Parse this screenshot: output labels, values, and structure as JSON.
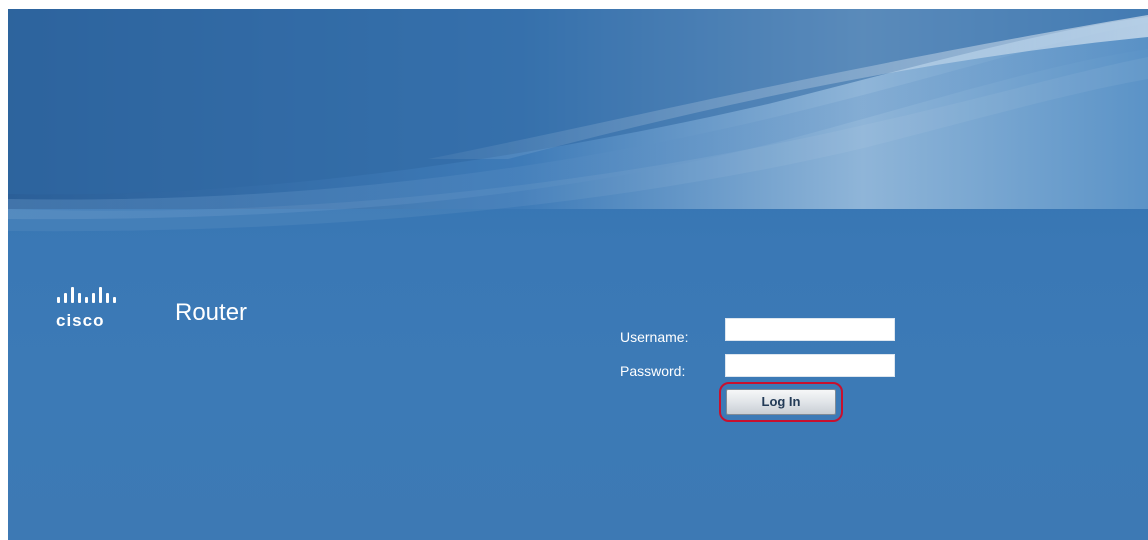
{
  "brand": {
    "logo_text": "cisco",
    "product_name": "Router"
  },
  "login": {
    "username_label": "Username:",
    "username_value": "",
    "password_label": "Password:",
    "password_value": "",
    "login_button": "Log In"
  },
  "icons": {
    "logo": "cisco-logo-icon"
  },
  "colors": {
    "background": "#3a78b5",
    "highlight_ring": "#c8102e",
    "text": "#ffffff"
  }
}
